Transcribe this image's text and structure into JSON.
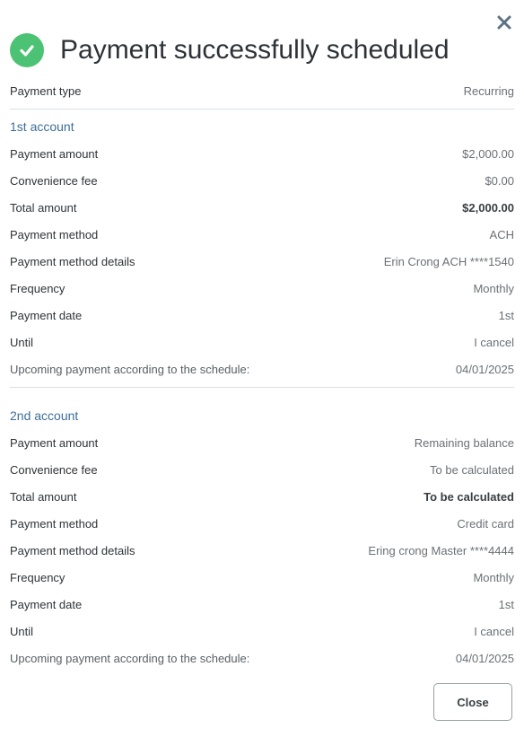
{
  "dialog": {
    "title": "Payment successfully scheduled",
    "close_icon": "close-icon",
    "success_icon": "check-circle-icon",
    "accent_success": "#4cc275",
    "accent_section": "#3d6e99"
  },
  "payment_type": {
    "label": "Payment type",
    "value": "Recurring"
  },
  "accounts": [
    {
      "title": "1st account",
      "rows": [
        {
          "label": "Payment amount",
          "value": "$2,000.00"
        },
        {
          "label": "Convenience fee",
          "value": "$0.00"
        },
        {
          "label": "Total amount",
          "value": "$2,000.00"
        },
        {
          "label": "Payment method",
          "value": "ACH"
        },
        {
          "label": "Payment method details",
          "value": "Erin Crong ACH ****1540"
        },
        {
          "label": "Frequency",
          "value": "Monthly"
        },
        {
          "label": "Payment date",
          "value": "1st"
        },
        {
          "label": "Until",
          "value": "I cancel"
        },
        {
          "label": "Upcoming payment according to the schedule:",
          "value": "04/01/2025"
        }
      ]
    },
    {
      "title": "2nd account",
      "rows": [
        {
          "label": "Payment amount",
          "value": "Remaining balance"
        },
        {
          "label": "Convenience fee",
          "value": "To be calculated"
        },
        {
          "label": "Total amount",
          "value": "To be calculated"
        },
        {
          "label": "Payment method",
          "value": "Credit card"
        },
        {
          "label": "Payment method details",
          "value": "Ering crong Master ****4444"
        },
        {
          "label": "Frequency",
          "value": "Monthly"
        },
        {
          "label": "Payment date",
          "value": "1st"
        },
        {
          "label": "Until",
          "value": "I cancel"
        },
        {
          "label": "Upcoming payment according to the schedule:",
          "value": "04/01/2025"
        }
      ]
    }
  ],
  "footer": {
    "close_label": "Close"
  }
}
